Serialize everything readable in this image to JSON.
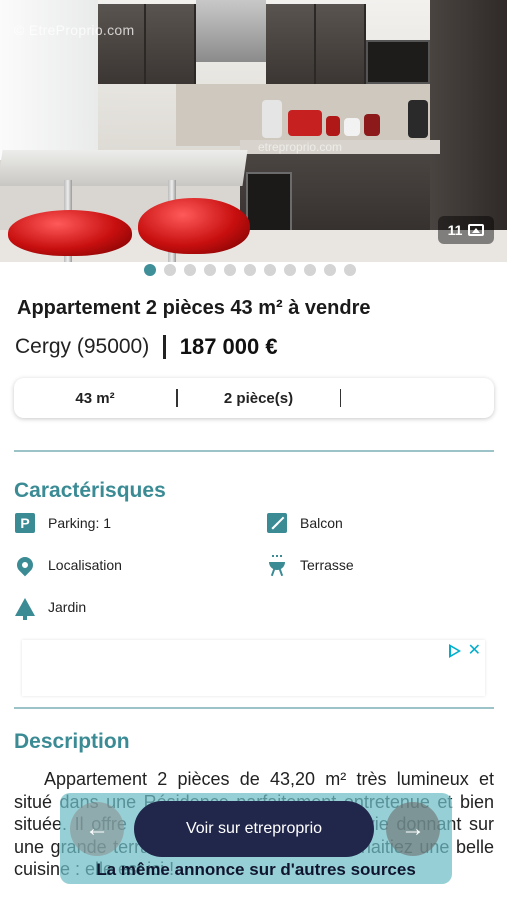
{
  "gallery": {
    "watermark": "© EtreProprio.com",
    "watermark_center": "etreproprio.com",
    "photo_count": "11",
    "photo_icon": "image-icon",
    "total_slides": 11,
    "active_slide": 1
  },
  "listing": {
    "title": "Appartement 2 pièces 43 m² à vendre",
    "city": "Cergy (95000)",
    "price": "187 000 €"
  },
  "summary": {
    "surface": "43 m²",
    "rooms": "2 pièce(s)"
  },
  "features": {
    "section_title": "Caractérisques",
    "items": [
      {
        "label": "Parking: 1",
        "icon": "parking-icon"
      },
      {
        "label": "Balcon",
        "icon": "balcony-icon"
      },
      {
        "label": "Localisation",
        "icon": "location-pin-icon"
      },
      {
        "label": "Terrasse",
        "icon": "grill-icon"
      },
      {
        "label": "Jardin",
        "icon": "tree-icon"
      }
    ]
  },
  "ad": {
    "play_icon": "adchoices-icon",
    "close_label": "✕"
  },
  "description": {
    "section_title": "Description",
    "text": "Appartement 2 pièces de 43,20 m² très lumineux et situé dans une Résidence parfaitement entretenue et bien située. Il offre une très agréable pièce de vie donnant sur une grande terrasse de 5,45 m². Vous souhaitiez une belle cuisine : elle est ici !"
  },
  "overlay": {
    "cta_label": "Voir sur etreproprio",
    "subtitle": "La même annonce sur d'autres sources",
    "prev_icon": "arrow-left-icon",
    "next_icon": "arrow-right-icon"
  },
  "colors": {
    "accent": "#3b8b95",
    "cta_bg": "#21264b",
    "banner_bg": "#6dbec6"
  }
}
